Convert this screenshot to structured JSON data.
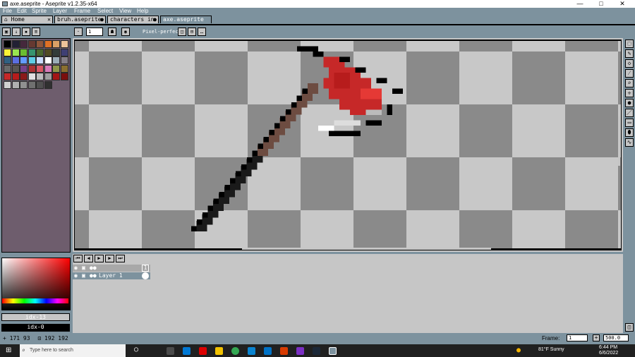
{
  "window": {
    "title": "axe.aseprite - Aseprite v1.2.35-x64",
    "min": "—",
    "max": "□",
    "close": "✕"
  },
  "menu": [
    "File",
    "Edit",
    "Sprite",
    "Layer",
    "Frame",
    "Select",
    "View",
    "Help"
  ],
  "tabs": [
    {
      "label": "⌂ Home",
      "close": "✕"
    },
    {
      "label": "bruh.aseprite",
      "close": "●"
    },
    {
      "label": "characters in s",
      "close": "●"
    },
    {
      "label": "axe.aseprite",
      "close": ""
    }
  ],
  "toolbar": {
    "brush_size": "1",
    "pixel_perfect_label": "Pixel-perfect"
  },
  "palette": [
    "#000000",
    "#222034",
    "#45283c",
    "#663931",
    "#8f563b",
    "#df7126",
    "#d9a066",
    "#eec39a",
    "#fbf236",
    "#99e550",
    "#6abe30",
    "#37946e",
    "#4b692f",
    "#524b24",
    "#323c39",
    "#3f3f74",
    "#306082",
    "#5b6ee1",
    "#639bff",
    "#5fcde4",
    "#cbdbfc",
    "#ffffff",
    "#9badb7",
    "#847e87",
    "#696a6a",
    "#595652",
    "#76428a",
    "#ac3232",
    "#d95763",
    "#d77bba",
    "#8f974a",
    "#8a6f30",
    "#c62828",
    "#b71c1c",
    "#8b1a1a",
    "#e0e0e0",
    "#bdbdbd",
    "#9e9e9e",
    "#a31515",
    "#7a0e0e",
    "#d0d0d0",
    "#b0b0b0",
    "#909090",
    "#707070",
    "#505050",
    "#303030"
  ],
  "color": {
    "fg_label": "idx-13",
    "bg_label": "idx-0"
  },
  "timeline": {
    "layer_name": "Layer 1",
    "frame_num": "1"
  },
  "status": {
    "cursor": "+ 171 93",
    "selection": "192 192",
    "frame_label": "Frame:",
    "frame_value": "1",
    "zoom_value": "500.0"
  },
  "taskbar": {
    "search_placeholder": "Type here to search",
    "weather": "81°F  Sunny",
    "time": "6:44 PM",
    "date": "6/6/2022"
  }
}
